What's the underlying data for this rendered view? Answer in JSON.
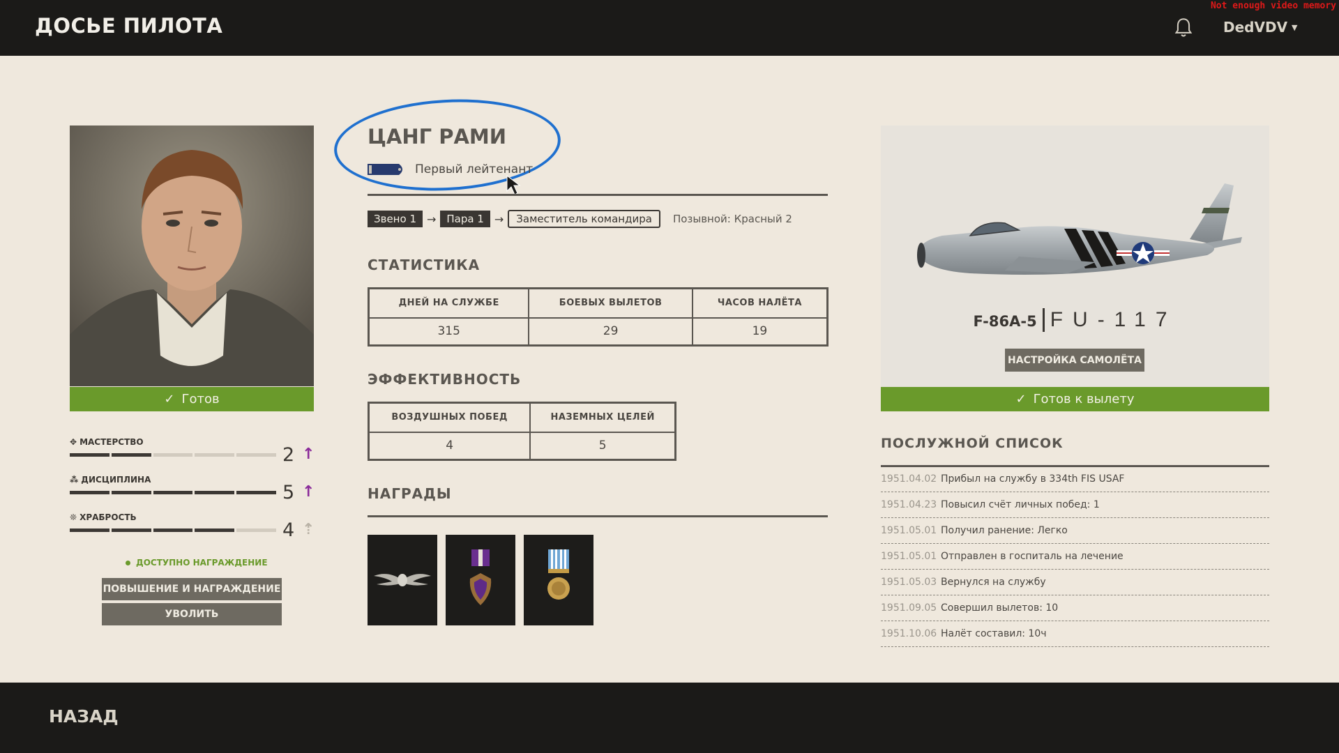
{
  "header": {
    "title": "ДОСЬЕ ПИЛОТА",
    "username": "DedVDV",
    "warning": "Not enough video memory"
  },
  "pilot": {
    "name": "ЦАНГ РАМИ",
    "rank": "Первый лейтенант",
    "status": "Готов",
    "chain": {
      "flight": "Звено 1",
      "pair": "Пара 1",
      "role": "Заместитель командира",
      "callsign": "Позывной: Красный 2"
    }
  },
  "skills": [
    {
      "name": "МАСТЕРСТВО",
      "value": "2",
      "max": 5,
      "level": 2,
      "arrow": "up"
    },
    {
      "name": "ДИСЦИПЛИНА",
      "value": "5",
      "max": 5,
      "level": 5,
      "arrow": "up"
    },
    {
      "name": "ХРАБРОСТЬ",
      "value": "4",
      "max": 5,
      "level": 4,
      "arrow": "dim"
    }
  ],
  "actions": {
    "award_available": "ДОСТУПНО НАГРАЖДЕНИЕ",
    "promote": "ПОВЫШЕНИЕ И НАГРАЖДЕНИЕ",
    "dismiss": "УВОЛИТЬ",
    "back": "НАЗАД"
  },
  "statistics": {
    "title": "СТАТИСТИКА",
    "headers": [
      "ДНЕЙ НА СЛУЖБЕ",
      "БОЕВЫХ ВЫЛЕТОВ",
      "ЧАСОВ НАЛЁТА"
    ],
    "values": [
      "315",
      "29",
      "19"
    ]
  },
  "efficiency": {
    "title": "ЭФФЕКТИВНОСТЬ",
    "headers": [
      "ВОЗДУШНЫХ ПОБЕД",
      "НАЗЕМНЫХ ЦЕЛЕЙ"
    ],
    "values": [
      "4",
      "5"
    ]
  },
  "awards": {
    "title": "НАГРАДЫ",
    "items": [
      "pilot-wings-icon",
      "purple-heart-medal-icon",
      "korean-service-medal-icon"
    ]
  },
  "aircraft": {
    "model": "F-86A-5",
    "tail": "FU-117",
    "setup": "НАСТРОЙКА САМОЛЁТА",
    "status": "Готов к вылету"
  },
  "service_record": {
    "title": "ПОСЛУЖНОЙ СПИСОК",
    "entries": [
      {
        "date": "1951.04.02",
        "text": "Прибыл на службу в 334th FIS USAF"
      },
      {
        "date": "1951.04.23",
        "text": "Повысил счёт личных побед: 1"
      },
      {
        "date": "1951.05.01",
        "text": "Получил ранение: Легко"
      },
      {
        "date": "1951.05.01",
        "text": "Отправлен в госпиталь на лечение"
      },
      {
        "date": "1951.05.03",
        "text": "Вернулся на службу"
      },
      {
        "date": "1951.09.05",
        "text": "Совершил вылетов: 10"
      },
      {
        "date": "1951.10.06",
        "text": "Налёт составил: 10ч"
      }
    ]
  },
  "colors": {
    "accent_green": "#6a9a2b",
    "annotation_blue": "#1f70cf",
    "arrow_purple": "#8a2b9a"
  }
}
